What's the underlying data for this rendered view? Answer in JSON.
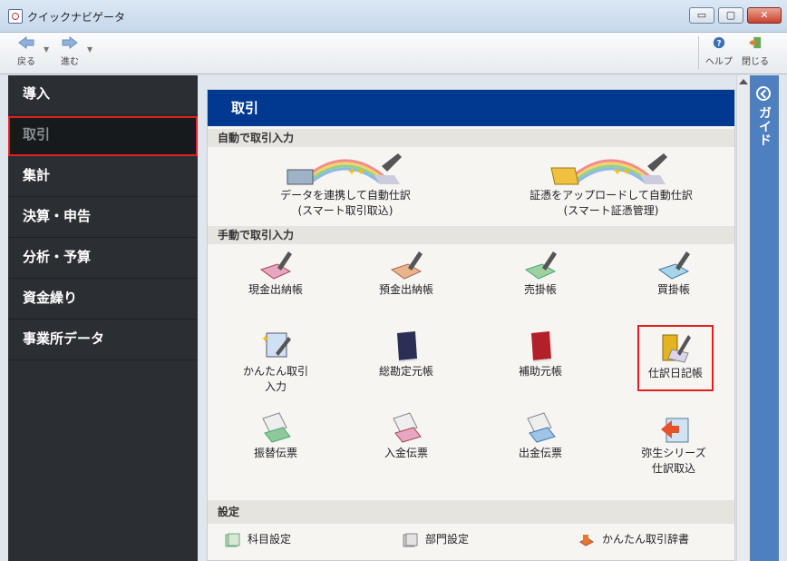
{
  "window": {
    "title": "クイックナビゲータ",
    "min": "▭",
    "max": "▢",
    "close": "✕"
  },
  "toolbar": {
    "back": "戻る",
    "forward": "進む",
    "help": "ヘルプ",
    "close": "閉じる"
  },
  "sidebar": {
    "items": [
      {
        "label": "導入"
      },
      {
        "label": "取引"
      },
      {
        "label": "集計"
      },
      {
        "label": "決算・申告"
      },
      {
        "label": "分析・予算"
      },
      {
        "label": "資金繰り"
      },
      {
        "label": "事業所データ"
      }
    ]
  },
  "main": {
    "title": "取引",
    "sections": {
      "auto": "自動で取引入力",
      "manual": "手動で取引入力",
      "settings": "設定"
    },
    "auto_items": [
      {
        "label": "データを連携して自動仕訳\n(スマート取引取込)",
        "icon": "smart-import-icon"
      },
      {
        "label": "証憑をアップロードして自動仕訳\n(スマート証憑管理)",
        "icon": "smart-voucher-icon"
      }
    ],
    "manual_items": [
      {
        "label": "現金出納帳",
        "icon": "cash-book-icon"
      },
      {
        "label": "預金出納帳",
        "icon": "deposit-book-icon"
      },
      {
        "label": "売掛帳",
        "icon": "receivable-book-icon"
      },
      {
        "label": "買掛帳",
        "icon": "payable-book-icon"
      },
      {
        "label": "かんたん取引\n入力",
        "icon": "easy-entry-icon"
      },
      {
        "label": "総勘定元帳",
        "icon": "general-ledger-icon"
      },
      {
        "label": "補助元帳",
        "icon": "sub-ledger-icon"
      },
      {
        "label": "仕訳日記帳",
        "icon": "journal-book-icon"
      },
      {
        "label": "振替伝票",
        "icon": "transfer-slip-icon"
      },
      {
        "label": "入金伝票",
        "icon": "receipt-slip-icon"
      },
      {
        "label": "出金伝票",
        "icon": "payment-slip-icon"
      },
      {
        "label": "弥生シリーズ\n仕訳取込",
        "icon": "yayoi-import-icon"
      }
    ],
    "settings_items": [
      {
        "label": "科目設定",
        "icon": "account-setting-icon"
      },
      {
        "label": "部門設定",
        "icon": "department-setting-icon"
      },
      {
        "label": "かんたん取引辞書",
        "icon": "easy-dictionary-icon"
      }
    ]
  },
  "guide": {
    "label": "ガイド"
  },
  "colors": {
    "header": "#00398f",
    "sidebar": "#2b2f33",
    "highlight": "#e02020",
    "guide": "#4e7fbf"
  }
}
